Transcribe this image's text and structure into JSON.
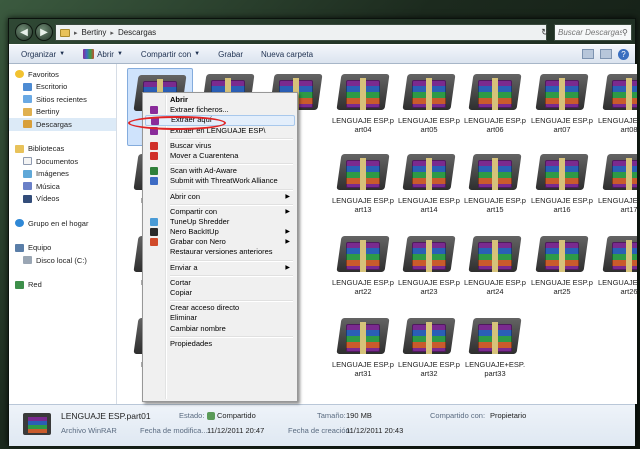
{
  "address": {
    "path": [
      "Bertiny",
      "Descargas"
    ],
    "search_placeholder": "Buscar Descargas"
  },
  "toolbar": {
    "organize": "Organizar",
    "open": "Abrir",
    "share": "Compartir con",
    "record": "Grabar",
    "new_folder": "Nueva carpeta"
  },
  "navpane": {
    "favorites": "Favoritos",
    "fav_items": [
      "Escritorio",
      "Sitios recientes",
      "Bertiny",
      "Descargas"
    ],
    "libraries": "Bibliotecas",
    "lib_items": [
      "Documentos",
      "Imágenes",
      "Música",
      "Vídeos"
    ],
    "homegroup": "Grupo en el hogar",
    "computer": "Equipo",
    "computer_items": [
      "Disco local (C:)"
    ],
    "network": "Red"
  },
  "files": [
    {
      "label": ""
    },
    {
      "label": ""
    },
    {
      "label": ""
    },
    {
      "label": "LENGUAJE ESP.part04"
    },
    {
      "label": "LENGUAJE ESP.part05"
    },
    {
      "label": "LENGUAJE ESP.part06"
    },
    {
      "label": "LENGUAJE ESP.part07"
    },
    {
      "label": "LENGUAJE ESP.part08"
    },
    {
      "label": "LENGUAJE ESP.part13"
    },
    {
      "label": "LENGUAJE ESP.part14"
    },
    {
      "label": "LENGUAJE ESP.part15"
    },
    {
      "label": "LENGUAJE ESP.part16"
    },
    {
      "label": "LENGUAJE ESP.part17"
    },
    {
      "label": "LENGUAJE ESP.part22"
    },
    {
      "label": "LENGUAJE ESP.part23"
    },
    {
      "label": "LENGUAJE ESP.part24"
    },
    {
      "label": "LENGUAJE ESP.part25"
    },
    {
      "label": "LENGUAJE ESP.part26"
    },
    {
      "label": "LENGUAJE ESP.part31"
    },
    {
      "label": "LENGUAJE ESP.part32"
    },
    {
      "label": "LENGUAJE+ESP.part33"
    }
  ],
  "partial_labels": [
    "LEN",
    "LEN",
    "LEN",
    "LEN"
  ],
  "context_menu": {
    "items": [
      "Abrir",
      "Extraer ficheros...",
      "Extraer aquí",
      "Extraer en LENGUAJE ESP\\",
      "Buscar virus",
      "Mover a Cuarentena",
      "Scan with Ad-Aware",
      "Submit with ThreatWork Alliance",
      "Abrir con",
      "Compartir con",
      "TuneUp Shredder",
      "Nero BackItUp",
      "Grabar con Nero",
      "Restaurar versiones anteriores",
      "Enviar a",
      "Cortar",
      "Copiar",
      "Crear acceso directo",
      "Eliminar",
      "Cambiar nombre",
      "Propiedades"
    ]
  },
  "details": {
    "name": "LENGUAJE ESP.part01",
    "type": "Archivo WinRAR",
    "state_key": "Estado:",
    "state_val": "Compartido",
    "modified_key": "Fecha de modifica...:",
    "modified_val": "11/12/2011 20:47",
    "size_key": "Tamaño:",
    "size_val": "190 MB",
    "created_key": "Fecha de creación:",
    "created_val": "11/12/2011 20:43",
    "shared_key": "Compartido con:",
    "shared_val": "Propietario"
  }
}
